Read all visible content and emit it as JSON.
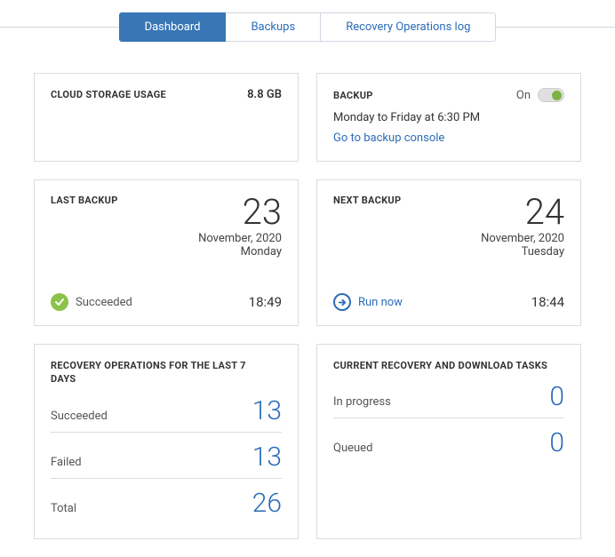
{
  "tabs": {
    "dashboard": "Dashboard",
    "backups": "Backups",
    "recovery_log": "Recovery Operations log"
  },
  "cloud_storage": {
    "title": "CLOUD STORAGE USAGE",
    "value": "8.8 GB"
  },
  "backup_settings": {
    "title": "BACKUP",
    "status": "On",
    "schedule": "Monday to Friday at 6:30 PM",
    "link": "Go to backup console"
  },
  "last_backup": {
    "title": "LAST BACKUP",
    "day": "23",
    "month_year": "November, 2020",
    "weekday": "Monday",
    "status": "Succeeded",
    "time": "18:49"
  },
  "next_backup": {
    "title": "NEXT BACKUP",
    "day": "24",
    "month_year": "November, 2020",
    "weekday": "Tuesday",
    "action": "Run now",
    "time": "18:44"
  },
  "recovery_ops": {
    "title": "RECOVERY OPERATIONS FOR THE LAST 7 DAYS",
    "rows": {
      "succeeded": {
        "label": "Succeeded",
        "value": "13"
      },
      "failed": {
        "label": "Failed",
        "value": "13"
      },
      "total": {
        "label": "Total",
        "value": "26"
      }
    }
  },
  "current_tasks": {
    "title": "CURRENT RECOVERY AND DOWNLOAD TASKS",
    "rows": {
      "in_progress": {
        "label": "In progress",
        "value": "0"
      },
      "queued": {
        "label": "Queued",
        "value": "0"
      }
    }
  }
}
